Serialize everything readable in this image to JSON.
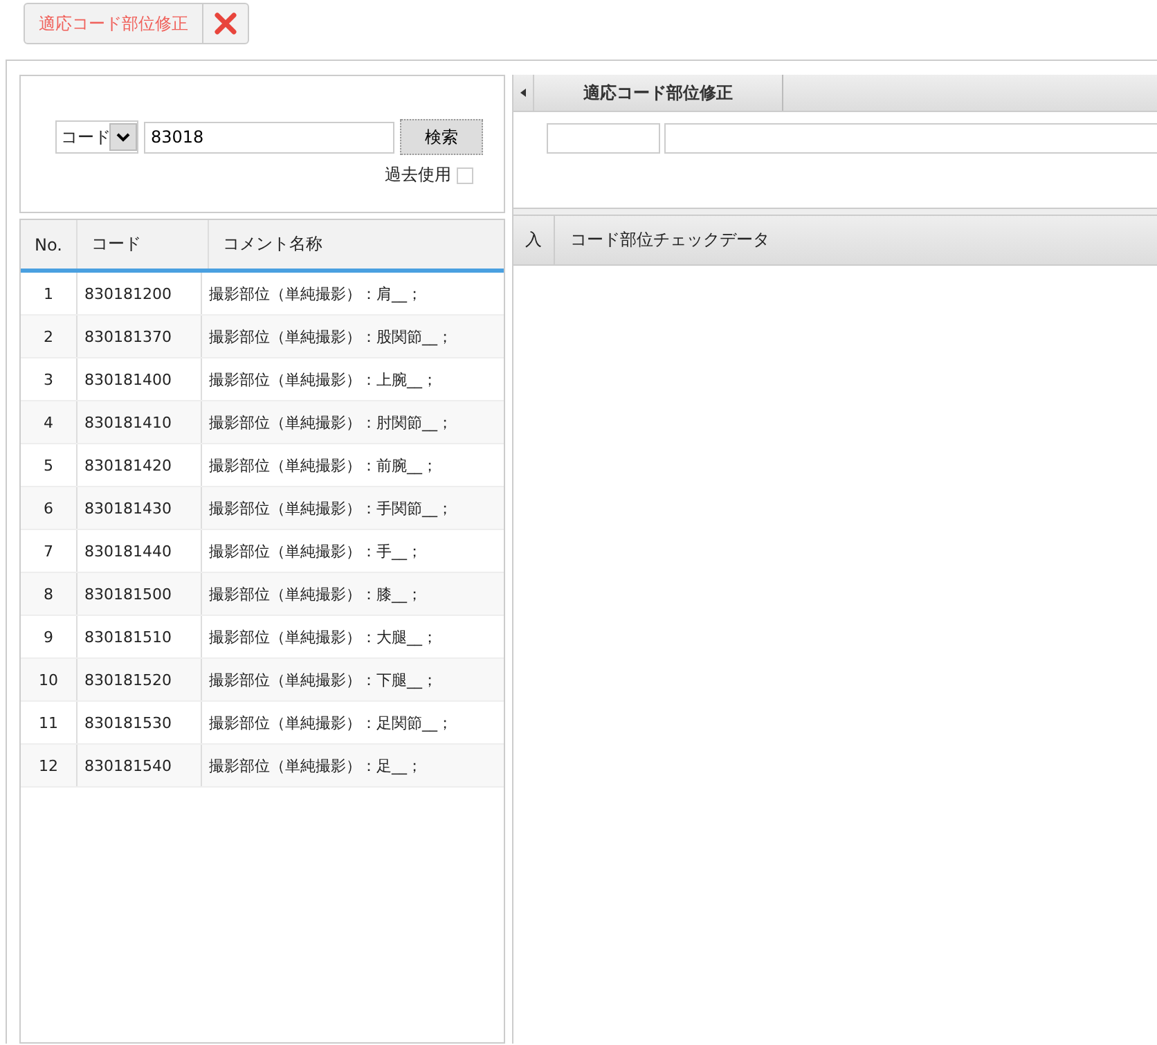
{
  "top_tab": {
    "label": "適応コード部位修正"
  },
  "search": {
    "select_value": "コード",
    "value": "83018",
    "button": "検索",
    "past_use": {
      "label": "過去使用",
      "checked": false
    }
  },
  "table": {
    "columns": [
      "No.",
      "コード",
      "コメント名称"
    ],
    "rows": [
      {
        "no": "1",
        "code": "830181200",
        "name": "撮影部位（単純撮影）：肩__；"
      },
      {
        "no": "2",
        "code": "830181370",
        "name": "撮影部位（単純撮影）：股関節__；"
      },
      {
        "no": "3",
        "code": "830181400",
        "name": "撮影部位（単純撮影）：上腕__；"
      },
      {
        "no": "4",
        "code": "830181410",
        "name": "撮影部位（単純撮影）：肘関節__；"
      },
      {
        "no": "5",
        "code": "830181420",
        "name": "撮影部位（単純撮影）：前腕__；"
      },
      {
        "no": "6",
        "code": "830181430",
        "name": "撮影部位（単純撮影）：手関節__；"
      },
      {
        "no": "7",
        "code": "830181440",
        "name": "撮影部位（単純撮影）：手__；"
      },
      {
        "no": "8",
        "code": "830181500",
        "name": "撮影部位（単純撮影）：膝__；"
      },
      {
        "no": "9",
        "code": "830181510",
        "name": "撮影部位（単純撮影）：大腿__；"
      },
      {
        "no": "10",
        "code": "830181520",
        "name": "撮影部位（単純撮影）：下腿__；"
      },
      {
        "no": "11",
        "code": "830181530",
        "name": "撮影部位（単純撮影）：足関節__；"
      },
      {
        "no": "12",
        "code": "830181540",
        "name": "撮影部位（単純撮影）：足__；"
      }
    ]
  },
  "right": {
    "tabs": [
      {
        "label": "適応コード部位修正",
        "selected": true
      }
    ],
    "grid_columns": [
      "入",
      "コード部位チェックデータ"
    ]
  }
}
